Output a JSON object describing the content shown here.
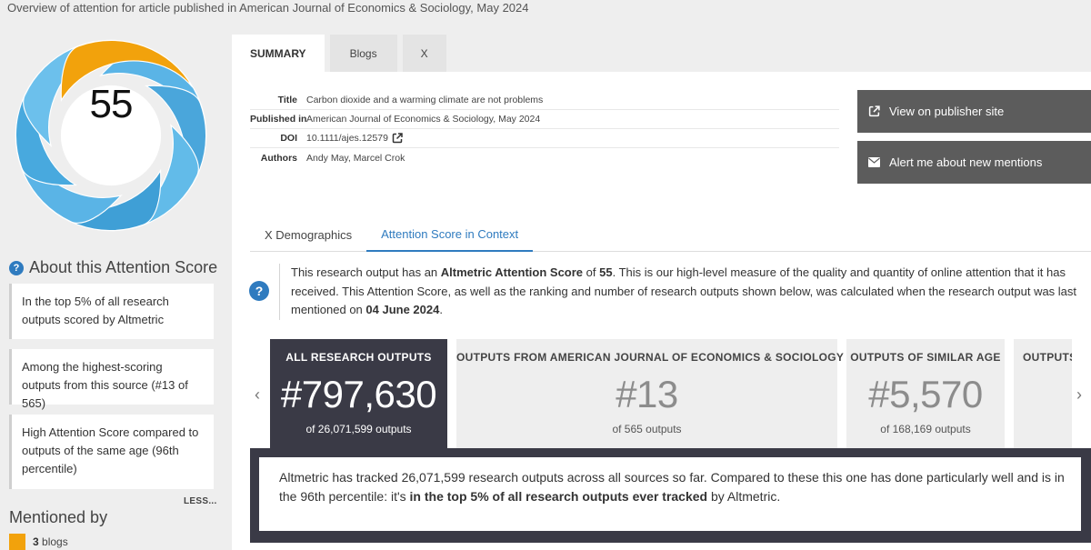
{
  "page_header": "Overview of attention for article published in American Journal of Economics & Sociology, May 2024",
  "score": {
    "value": "55",
    "colors": {
      "blogs": "#f2a20c",
      "x": "#5ab4e6"
    }
  },
  "about": {
    "heading": "About this Attention Score",
    "cards": [
      "In the top 5% of all research outputs scored by Altmetric",
      "Among the highest-scoring outputs from this source (#13 of 565)",
      "High Attention Score compared to outputs of the same age (96th percentile)"
    ],
    "less_label": "LESS..."
  },
  "mentioned": {
    "heading": "Mentioned by",
    "items": [
      {
        "count": "3",
        "label": "blogs",
        "color": "#f2a20c"
      }
    ]
  },
  "tabs": [
    "SUMMARY",
    "Blogs",
    "X"
  ],
  "article": {
    "title_label": "Title",
    "title": "Carbon dioxide and a warming climate are not problems",
    "published_label": "Published in",
    "published": "American Journal of Economics & Sociology, May 2024",
    "doi_label": "DOI",
    "doi": "10.1111/ajes.12579",
    "authors_label": "Authors",
    "authors": "Andy May, Marcel Crok"
  },
  "actions": {
    "publisher": "View on publisher site",
    "alert": "Alert me about new mentions"
  },
  "sub_tabs": [
    "X Demographics",
    "Attention Score in Context"
  ],
  "context": {
    "p1": "This research output has an ",
    "b1": "Altmetric Attention Score",
    "p2": " of ",
    "b2": "55",
    "p3": ". This is our high-level measure of the quality and quantity of online attention that it has received. This Attention Score, as well as the ranking and number of research outputs shown below, was calculated when the research output was last mentioned on ",
    "b3": "04 June 2024",
    "p4": "."
  },
  "rankings": [
    {
      "title": "ALL RESEARCH OUTPUTS",
      "rank": "#797,630",
      "sub": "of 26,071,599 outputs"
    },
    {
      "title": "OUTPUTS FROM AMERICAN JOURNAL OF ECONOMICS & SOCIOLOGY",
      "rank": "#13",
      "sub": "of 565 outputs"
    },
    {
      "title": "OUTPUTS OF SIMILAR AGE",
      "rank": "#5,570",
      "sub": "of 168,169 outputs"
    },
    {
      "title": "OUTPUTS"
    }
  ],
  "percentile": {
    "p1": "Altmetric has tracked 26,071,599 research outputs across all sources so far. Compared to these this one has done particularly well and is in the 96th percentile: it's ",
    "b1": "in the top 5% of all research outputs ever tracked",
    "p2": " by Altmetric."
  }
}
